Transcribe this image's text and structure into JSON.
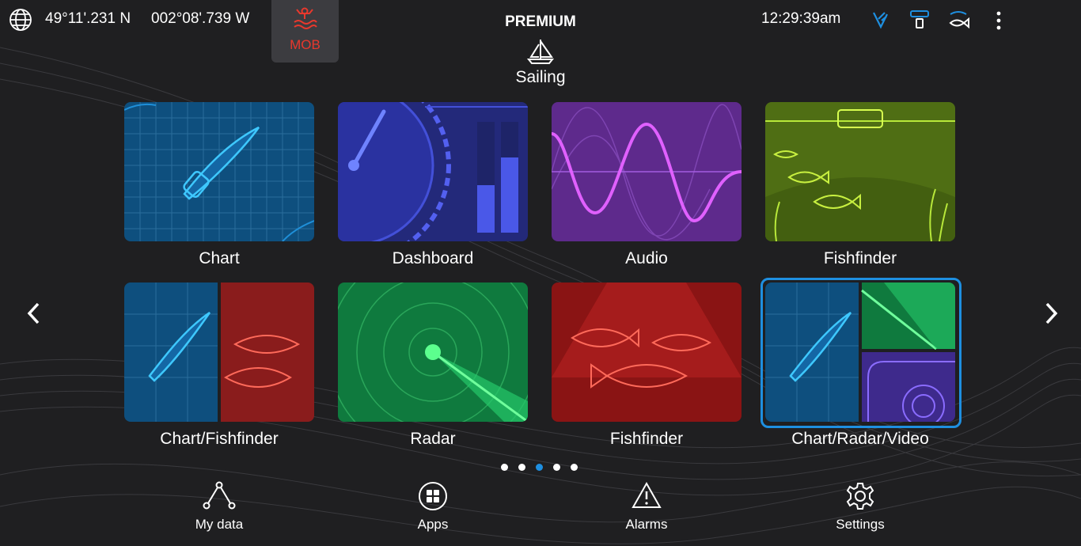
{
  "status_bar": {
    "latitude": "49°11'.231 N",
    "longitude": "002°08'.739 W",
    "mob_label": "MOB",
    "mode_title": "PREMIUM",
    "time": "12:29:39am",
    "icons": [
      "globe-icon",
      "mob-icon",
      "autopilot-icon",
      "sonar-transducer-icon",
      "fish-icon",
      "more-icon"
    ]
  },
  "profile": {
    "name": "Sailing",
    "icon": "sailboat-icon"
  },
  "apps": [
    {
      "label": "Chart"
    },
    {
      "label": "Dashboard"
    },
    {
      "label": "Audio"
    },
    {
      "label": "Fishfinder"
    },
    {
      "label": "Chart/Fishfinder"
    },
    {
      "label": "Radar"
    },
    {
      "label": "Fishfinder"
    },
    {
      "label": "Chart/Radar/Video"
    }
  ],
  "pagination": {
    "pages": 5,
    "current": 3
  },
  "bottom_nav": [
    {
      "label": "My data",
      "icon": "network-icon"
    },
    {
      "label": "Apps",
      "icon": "apps-grid-icon"
    },
    {
      "label": "Alarms",
      "icon": "alarm-triangle-icon"
    },
    {
      "label": "Settings",
      "icon": "gear-icon"
    }
  ],
  "colors": {
    "background": "#1f1f21",
    "accent": "#1e8fe0",
    "mob_red": "#e8382d"
  }
}
